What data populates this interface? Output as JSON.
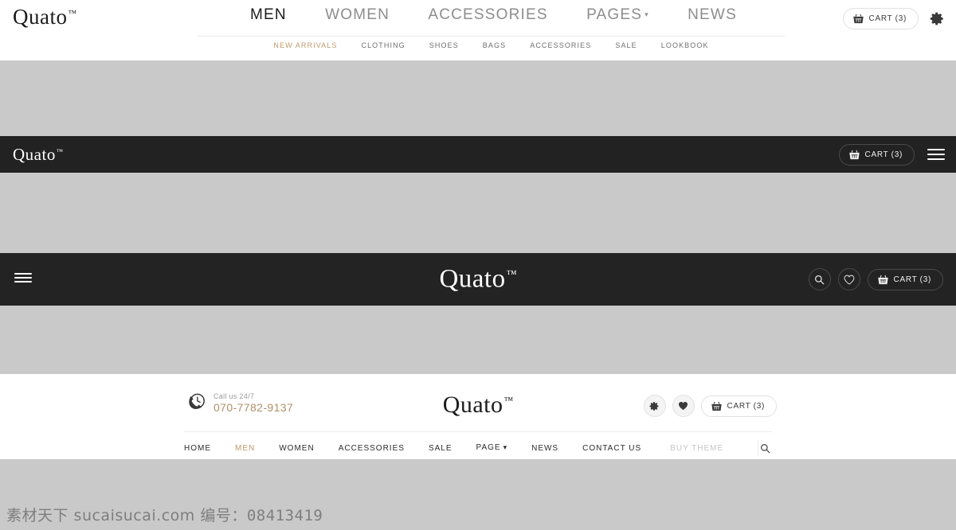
{
  "brand": {
    "name": "Quato",
    "tm": "™"
  },
  "header_topbar": {
    "nav": [
      {
        "label": "MEN",
        "active": true,
        "caret": false
      },
      {
        "label": "WOMEN",
        "active": false,
        "caret": false
      },
      {
        "label": "ACCESSORIES",
        "active": false,
        "caret": false
      },
      {
        "label": "PAGES",
        "active": false,
        "caret": true
      },
      {
        "label": "NEWS",
        "active": false,
        "caret": false
      }
    ],
    "subnav": [
      {
        "label": "NEW ARRIVALS",
        "active": true
      },
      {
        "label": "CLOTHING",
        "active": false
      },
      {
        "label": "SHOES",
        "active": false
      },
      {
        "label": "BAGS",
        "active": false
      },
      {
        "label": "ACCESSORIES",
        "active": false
      },
      {
        "label": "SALE",
        "active": false
      },
      {
        "label": "LOOKBOOK",
        "active": false
      }
    ],
    "cart_label": "CART (3)",
    "caret_glyph": "▾"
  },
  "header_dark_compact": {
    "cart_label": "CART (3)"
  },
  "header_dark_tall": {
    "cart_label": "CART (3)"
  },
  "header_phone": {
    "call_label": "Call us 24/7",
    "phone_number": "070-7782-9137",
    "cart_label": "CART (3)",
    "nav": [
      {
        "label": "HOME",
        "active": false,
        "caret": false
      },
      {
        "label": "MEN",
        "active": true,
        "caret": false
      },
      {
        "label": "WOMEN",
        "active": false,
        "caret": false
      },
      {
        "label": "ACCESSORIES",
        "active": false,
        "caret": false
      },
      {
        "label": "SALE",
        "active": false,
        "caret": false
      },
      {
        "label": "PAGE",
        "active": false,
        "caret": true
      },
      {
        "label": "NEWS",
        "active": false,
        "caret": false
      },
      {
        "label": "CONTACT US",
        "active": false,
        "caret": false
      }
    ],
    "search_placeholder": "BUY THEME",
    "search_value": ""
  },
  "watermark": {
    "site": "素材天下 sucaisucai.com",
    "code_label": "编号：",
    "code": "08413419"
  },
  "colors": {
    "accent": "#bd9a6a",
    "dark_bar": "#222222",
    "spacer": "#c9c9c9",
    "muted_text": "#8d8d8d"
  }
}
